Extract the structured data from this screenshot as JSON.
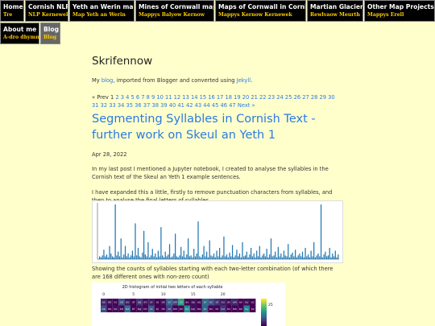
{
  "nav": [
    {
      "label": "Home",
      "sub": "Tre"
    },
    {
      "label": "Cornish NLP",
      "sub": "NLP Kernewek"
    },
    {
      "label": "Yeth an Werin map",
      "sub": "Map Yeth an Werin"
    },
    {
      "label": "Mines of Cornwall maps",
      "sub": "Mappys Balyow Kernow"
    },
    {
      "label": "Maps of Cornwall in Cornish",
      "sub": "Mappys Kernow Kernewek"
    },
    {
      "label": "Martian Glaciers",
      "sub": "Rewlvaow Meurth"
    },
    {
      "label": "Other Map Projects",
      "sub": "Mappys Erell"
    },
    {
      "label": "About me",
      "sub": "A-dro dhymm"
    },
    {
      "label": "Blog",
      "sub": "Blog"
    }
  ],
  "site": {
    "title": "Skrifennow",
    "intro_prefix": "My ",
    "intro_link1": "blog",
    "intro_mid": ", imported from Blogger and converted using ",
    "intro_link2": "Jekyll",
    "intro_suffix": "."
  },
  "pager": {
    "first_line_prefix": "« Prev",
    "current": "1",
    "pages_line1": "2 3 4 5 6 7 8 9 10 11 12 13 14 15 16 17 18 19 20 21 22 23 24 25 26 27 28 29 30",
    "pages_line2": "31 32 33 34 35 36 37 38 39 40 41 42 43 44 45 46 47",
    "next": "Next »"
  },
  "post": {
    "title": "Segmenting Syllables in Cornish Text - further work on Skeul an Yeth 1",
    "date": "Apr 28, 2022",
    "p1_prefix": "In my ",
    "p1_link1": "last post",
    "p1_mid": " I mentioned a ",
    "p1_link2": "Jupyter notebook",
    "p1_suffix": ", I created to analyse the syllables in the Cornish text of the Skeul an Yeth 1 example sentences.",
    "p2": "I have expanded this a little, firstly to remove punctuation characters from syllables, and then to analyse the final letters of syllables.",
    "caption": "Showing the counts of syllables starting with each two-letter combination (of which there are 168 different ones with non-zero count)"
  },
  "chart_data": [
    {
      "type": "bar",
      "title": "",
      "xlabel": "",
      "ylabel": "",
      "values": [
        3,
        2,
        4,
        10,
        3,
        5,
        2,
        14,
        6,
        3,
        2,
        58,
        4,
        8,
        3,
        22,
        2,
        5,
        14,
        3,
        6,
        2,
        4,
        9,
        3,
        38,
        4,
        12,
        3,
        2,
        7,
        30,
        5,
        3,
        18,
        2,
        4,
        11,
        3,
        6,
        2,
        9,
        3,
        34,
        4,
        2,
        8,
        3,
        5,
        16,
        2,
        3,
        6,
        27,
        3,
        2,
        4,
        13,
        3,
        9,
        2,
        5,
        22,
        3,
        4,
        2,
        11,
        3,
        6,
        40,
        3,
        2,
        5,
        14,
        3,
        8,
        2,
        20,
        4,
        3,
        6,
        2,
        9,
        3,
        12,
        2,
        4,
        24,
        3,
        5,
        2,
        7,
        3,
        15,
        2,
        4,
        10,
        3,
        6,
        2,
        18,
        3,
        4,
        8,
        2,
        5,
        12,
        3,
        6,
        2,
        9,
        3,
        14,
        2,
        4,
        6,
        3,
        11,
        2,
        5,
        22,
        3,
        4,
        8,
        2,
        13,
        3,
        6,
        2,
        9,
        4,
        3,
        16,
        2,
        5,
        7,
        3,
        10,
        2,
        4,
        6,
        3,
        8,
        2,
        12,
        3,
        5,
        2,
        9,
        3,
        18,
        2,
        4,
        6,
        3,
        58,
        2,
        5,
        8,
        3,
        4,
        12,
        2,
        6,
        3,
        9,
        2,
        5
      ]
    },
    {
      "type": "heatmap",
      "title": "2D histogram of initial two letters of each syllable",
      "x_ticks": [
        "0",
        "5",
        "10",
        "15",
        "20"
      ],
      "colorbar_ticks": [
        "25"
      ],
      "rows": [
        [
          "aa",
          "ab",
          "ac",
          "ad",
          "ae",
          "af",
          "ag",
          "ah",
          "ai",
          "aj",
          "ak",
          "al",
          "am",
          "an",
          "ao",
          "ap",
          "aq",
          "ar",
          "as",
          "at",
          "au",
          "av",
          "aw",
          "ax",
          "ay",
          "az"
        ],
        [
          "ba",
          "bb",
          "bc",
          "bd",
          "be",
          "bf",
          "bg",
          "bh",
          "bi",
          "bj",
          "bk",
          "bl",
          "bm",
          "bn",
          "bo",
          "bp",
          "bq",
          "br",
          "bs",
          "bt",
          "bu",
          "bv",
          "bw",
          "bx",
          "by",
          "bz"
        ]
      ],
      "values": [
        [
          3,
          1,
          0,
          6,
          2,
          0,
          4,
          1,
          2,
          0,
          1,
          8,
          5,
          14,
          0,
          1,
          0,
          9,
          6,
          4,
          2,
          1,
          3,
          0,
          1,
          0
        ],
        [
          6,
          0,
          1,
          0,
          9,
          0,
          1,
          0,
          7,
          0,
          0,
          5,
          0,
          0,
          12,
          1,
          0,
          8,
          0,
          0,
          4,
          0,
          0,
          0,
          11,
          0
        ]
      ]
    }
  ]
}
